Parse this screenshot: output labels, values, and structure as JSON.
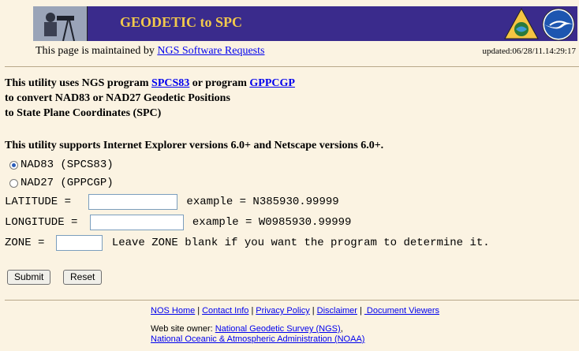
{
  "banner": {
    "title": "GEODETIC to SPC",
    "photo_icon": "surveyor-photo",
    "logo_left": "ngs-triangle-logo",
    "logo_right": "noaa-logo"
  },
  "maintenance": {
    "prefix": "This page is maintained by ",
    "link": "NGS Software Requests",
    "updated": "updated:06/28/11.14:29:17"
  },
  "intro": {
    "line1_prefix": "This utility uses NGS program ",
    "link1": "SPCS83",
    "line1_mid": " or program ",
    "link2": "GPPCGP",
    "line2": "to convert NAD83 or NAD27 Geodetic Positions",
    "line3": "to State Plane Coordinates (SPC)"
  },
  "support_text": "This utility supports Internet Explorer versions 6.0+ and Netscape versions 6.0+.",
  "datum_options": [
    {
      "label": "NAD83 (SPCS83)",
      "checked": true
    },
    {
      "label": "NAD27 (GPPCGP)",
      "checked": false
    }
  ],
  "fields": {
    "latitude_label": "LATITUDE = ",
    "latitude_value": "",
    "latitude_hint": "example = N385930.99999",
    "longitude_label": "LONGITUDE = ",
    "longitude_value": "",
    "longitude_hint": "example = W0985930.99999",
    "zone_label": "ZONE = ",
    "zone_value": "",
    "zone_hint": "Leave ZONE blank if you want the program to determine it."
  },
  "buttons": {
    "submit": "Submit",
    "reset": "Reset"
  },
  "footer": {
    "links": [
      "NOS Home",
      "Contact Info",
      "Privacy Policy",
      "Disclaimer",
      " Document Viewers"
    ],
    "owner_prefix": "Web site owner: ",
    "owner_link1": "National Geodetic Survey (NGS)",
    "owner_sep": ",",
    "owner_link2": "National Oceanic & Atmospheric Administration (NOAA)"
  },
  "colors": {
    "banner_bg": "#3a2b8c",
    "title_color": "#f2c94c",
    "page_bg": "#fbf3e2",
    "link": "#0000ee"
  }
}
